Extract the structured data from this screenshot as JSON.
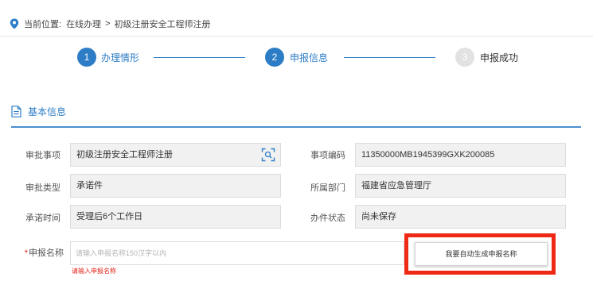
{
  "breadcrumb": {
    "label": "当前位置:",
    "items": [
      "在线办理",
      "初级注册安全工程师注册"
    ],
    "separator": ">"
  },
  "steps": [
    {
      "number": "1",
      "label": "办理情形",
      "state": "active"
    },
    {
      "number": "2",
      "label": "申报信息",
      "state": "active"
    },
    {
      "number": "3",
      "label": "申报成功",
      "state": "inactive"
    }
  ],
  "section": {
    "title": "基本信息"
  },
  "fields": {
    "approval_item": {
      "label": "审批事项",
      "value": "初级注册安全工程师注册"
    },
    "item_code": {
      "label": "事项编码",
      "value": "11350000MB1945399GXK200085"
    },
    "approval_type": {
      "label": "审批类型",
      "value": "承诺件"
    },
    "department": {
      "label": "所属部门",
      "value": "福建省应急管理厅"
    },
    "promise_time": {
      "label": "承诺时间",
      "value": "受理后6个工作日"
    },
    "status": {
      "label": "办件状态",
      "value": "尚未保存"
    }
  },
  "application_name": {
    "required_mark": "*",
    "label": "申报名称",
    "value": "",
    "placeholder": "请输入申报名称150汉字以内",
    "error": "请输入申报名称",
    "auto_button": "我要自动生成申报名称"
  },
  "colors": {
    "accent": "#2d7dc6",
    "error": "#e2231a",
    "highlight_frame": "#ee2a16",
    "inactive_step": "#e2e2e2"
  }
}
